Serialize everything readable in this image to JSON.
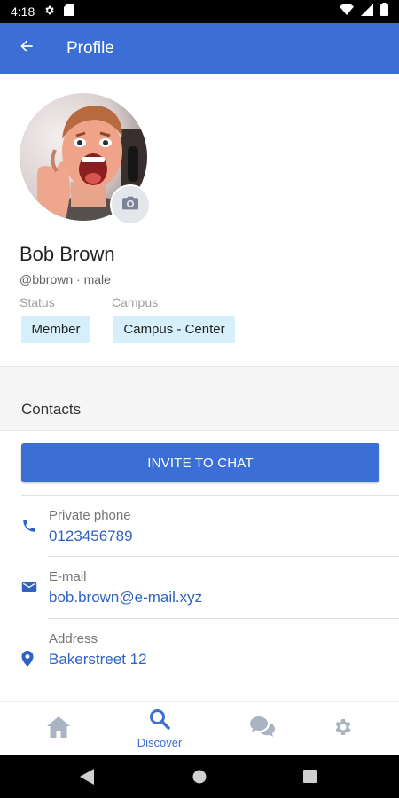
{
  "status_bar": {
    "time": "4:18",
    "icons": [
      "gear-icon",
      "sd-card-icon",
      "wifi-icon",
      "signal-icon",
      "battery-icon"
    ]
  },
  "app_bar": {
    "title": "Profile",
    "back_icon": "arrow-back-icon",
    "color": "#3b6fd6"
  },
  "profile": {
    "name": "Bob Brown",
    "handle": "@bbrown · male",
    "status_label": "Status",
    "status_value": "Member",
    "campus_label": "Campus",
    "campus_value": "Campus - Center",
    "chip_color": "#d7eefb"
  },
  "contacts": {
    "title": "Contacts",
    "invite_label": "INVITE TO CHAT",
    "items": [
      {
        "icon": "phone-icon",
        "label": "Private phone",
        "value": "0123456789"
      },
      {
        "icon": "email-icon",
        "label": "E-mail",
        "value": "bob.brown@e-mail.xyz"
      },
      {
        "icon": "location-icon",
        "label": "Address",
        "value": "Bakerstreet 12"
      }
    ],
    "link_color": "#2f63c2"
  },
  "bottom_nav": {
    "items": [
      {
        "icon": "home-icon",
        "label": ""
      },
      {
        "icon": "search-icon",
        "label": "Discover",
        "active": true
      },
      {
        "icon": "chat-icon",
        "label": ""
      },
      {
        "icon": "settings-icon",
        "label": ""
      }
    ]
  },
  "system_nav": {
    "icons": [
      "back-triangle-icon",
      "home-circle-icon",
      "recents-square-icon"
    ]
  }
}
